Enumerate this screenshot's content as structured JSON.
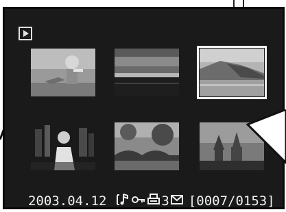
{
  "status": {
    "date": "2003.04.12",
    "print_count": "3",
    "counter": "[0007/0153]"
  },
  "icons": {
    "mode": "play-mode-icon",
    "status_icons": [
      "voice-memo-icon",
      "lock-key-icon",
      "printer-icon",
      "mail-icon"
    ]
  },
  "thumbnails": [
    {
      "subject": "child-at-beach",
      "selected": false
    },
    {
      "subject": "sunset-over-sea",
      "selected": false
    },
    {
      "subject": "coastal-cliffs",
      "selected": true
    },
    {
      "subject": "woman-city-night",
      "selected": false
    },
    {
      "subject": "bridge-and-trees",
      "selected": false
    },
    {
      "subject": "cathedral-skyline",
      "selected": false
    }
  ],
  "colors": {
    "lcd_background": "#1a1a1a",
    "text": "#f0f0f0",
    "selection": "#f2f2f2"
  }
}
